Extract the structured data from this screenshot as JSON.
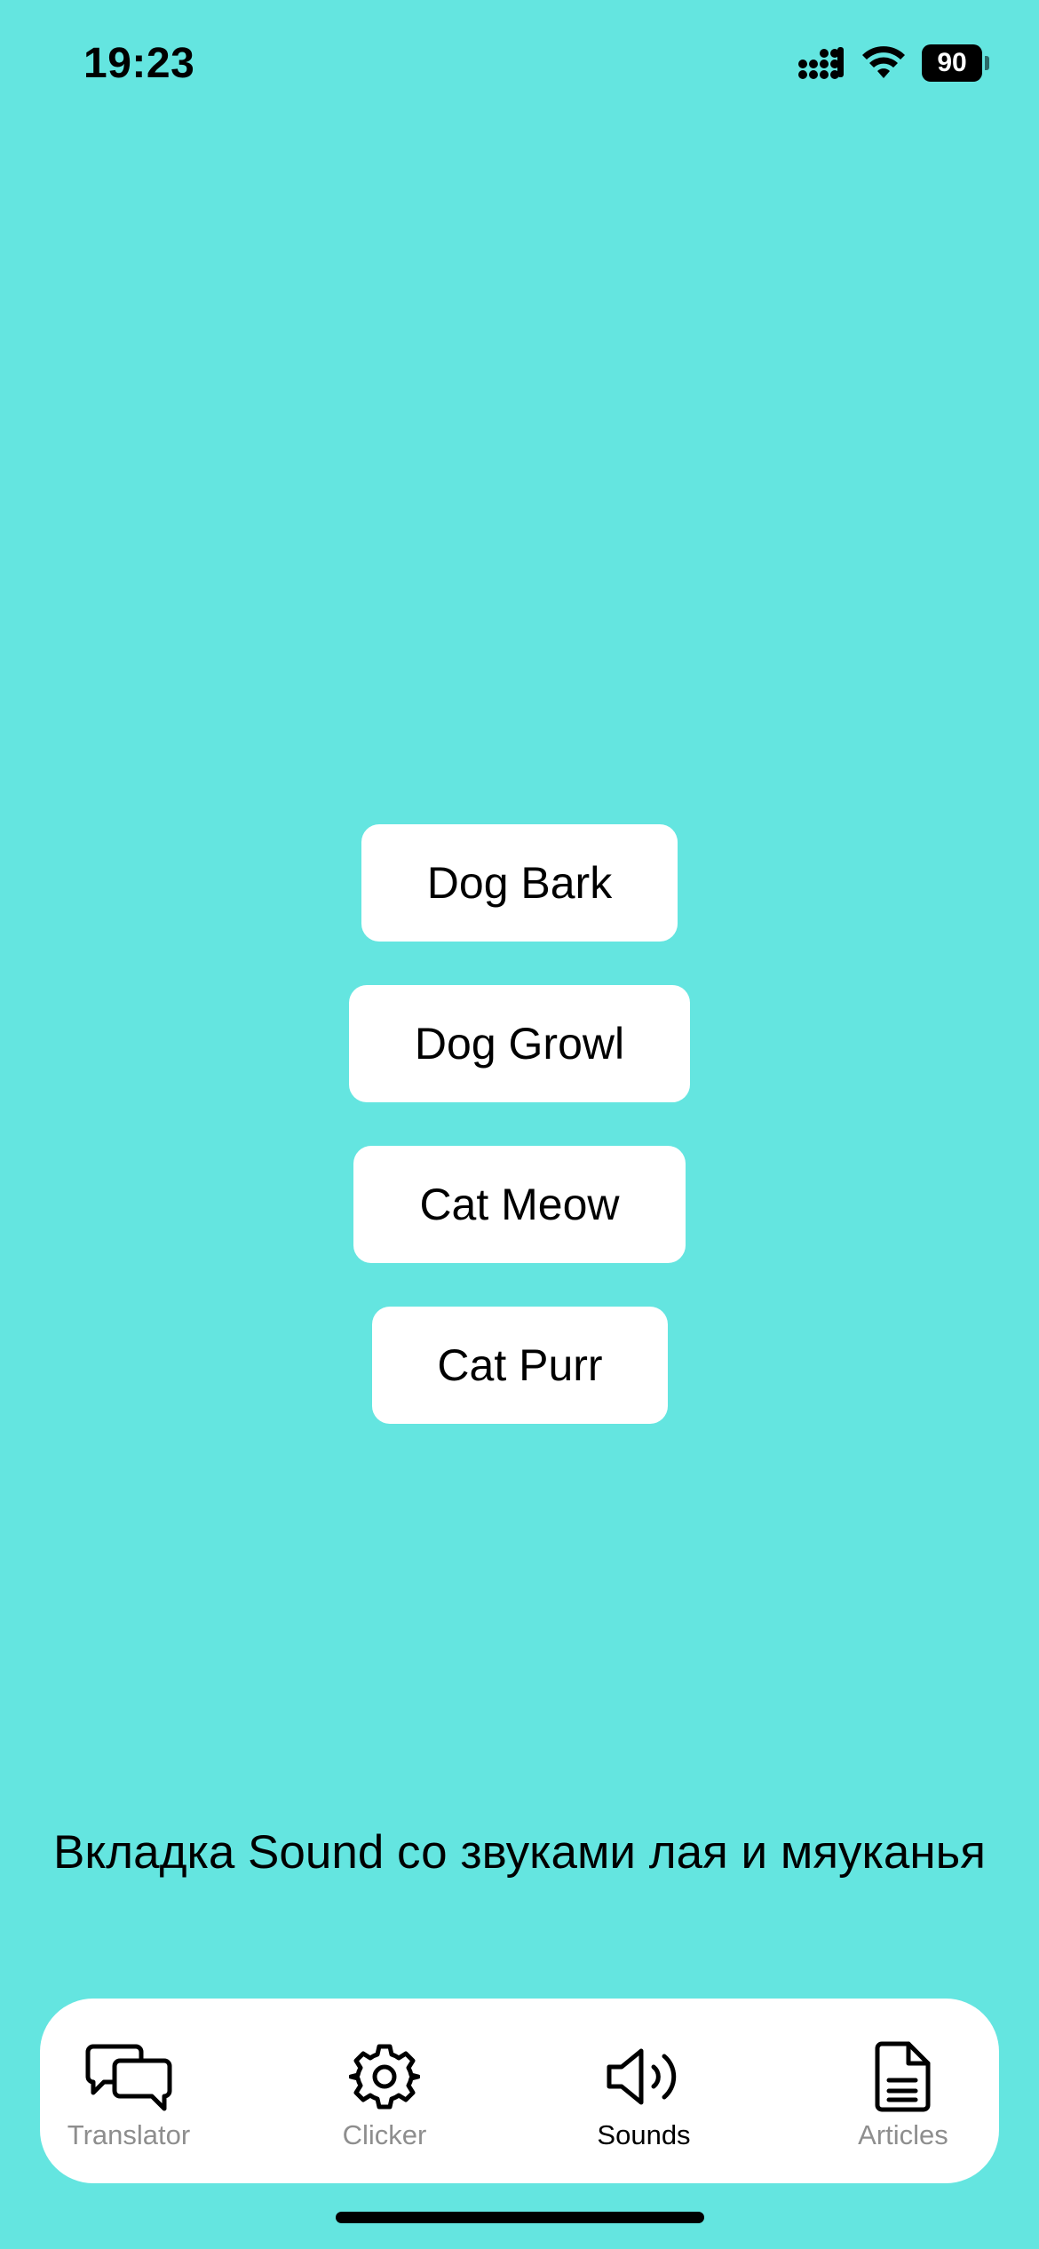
{
  "status_bar": {
    "time": "19:23",
    "battery": "90",
    "icons": [
      "cellular-signal-icon",
      "wifi-icon",
      "battery-icon"
    ]
  },
  "sounds": {
    "buttons": [
      {
        "label": "Dog Bark"
      },
      {
        "label": "Dog Growl"
      },
      {
        "label": "Cat Meow"
      },
      {
        "label": "Cat Purr"
      }
    ]
  },
  "caption": "Вкладка Sound со звуками лая и мяуканья",
  "tab_bar": {
    "active": "Sounds",
    "tabs": [
      {
        "label": "Translator",
        "icon": "chat-bubbles-icon"
      },
      {
        "label": "Clicker",
        "icon": "gear-icon"
      },
      {
        "label": "Sounds",
        "icon": "speaker-icon"
      },
      {
        "label": "Articles",
        "icon": "document-icon"
      }
    ]
  },
  "colors": {
    "background": "#64E5E0",
    "button_bg": "#FFFFFF",
    "tab_bar_bg": "#FFFFFF",
    "tab_inactive": "#8E8E8E",
    "tab_active": "#000000"
  }
}
